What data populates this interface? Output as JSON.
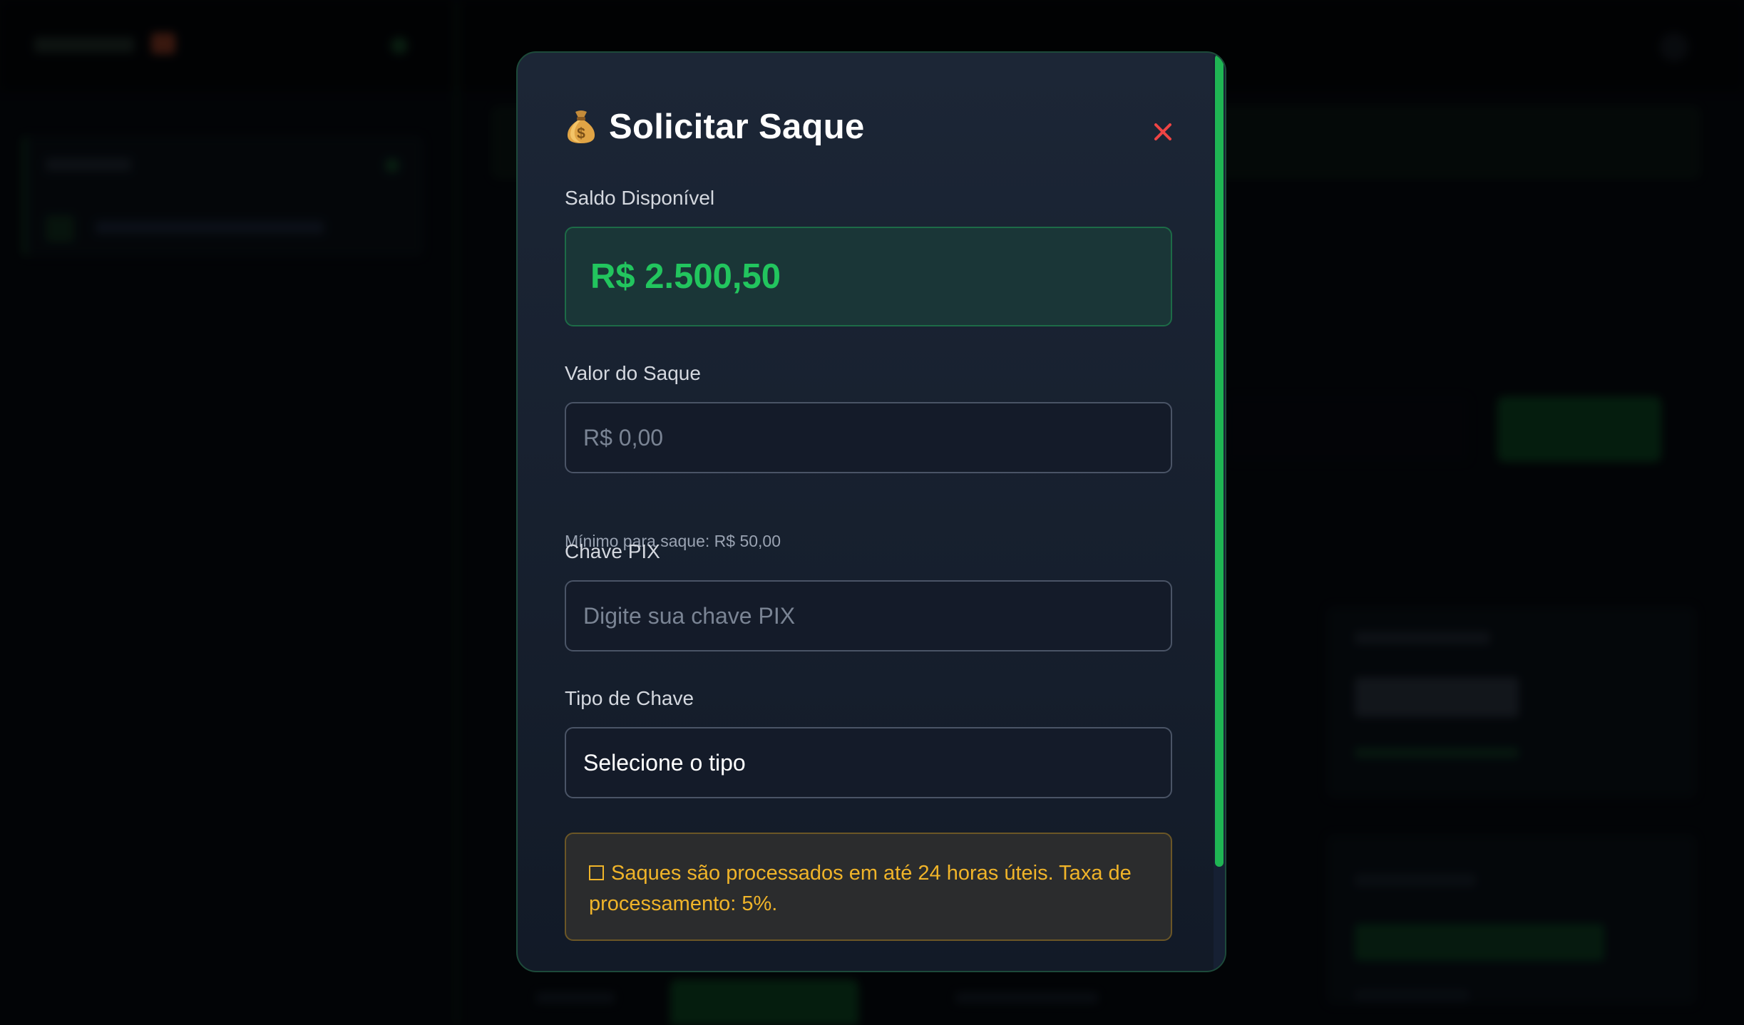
{
  "modal": {
    "title": "Solicitar Saque",
    "icon": "money-bag-icon",
    "close_icon": "close-icon",
    "balance": {
      "label": "Saldo Disponível",
      "value": "R$ 2.500,50"
    },
    "amount": {
      "label": "Valor do Saque",
      "placeholder": "R$ 0,00",
      "hint": "Mínimo para saque: R$ 50,00"
    },
    "pix_key": {
      "label": "Chave PIX",
      "placeholder": "Digite sua chave PIX"
    },
    "key_type": {
      "label": "Tipo de Chave",
      "selected": "Selecione o tipo"
    },
    "notice": {
      "icon": "square-icon",
      "text": "Saques são processados em até 24 horas úteis. Taxa de processamento: 5%."
    }
  },
  "colors": {
    "accent_green": "#22c55e",
    "warning": "#f0b429",
    "close_red": "#ef4444",
    "modal_bg": "#1a2332"
  }
}
